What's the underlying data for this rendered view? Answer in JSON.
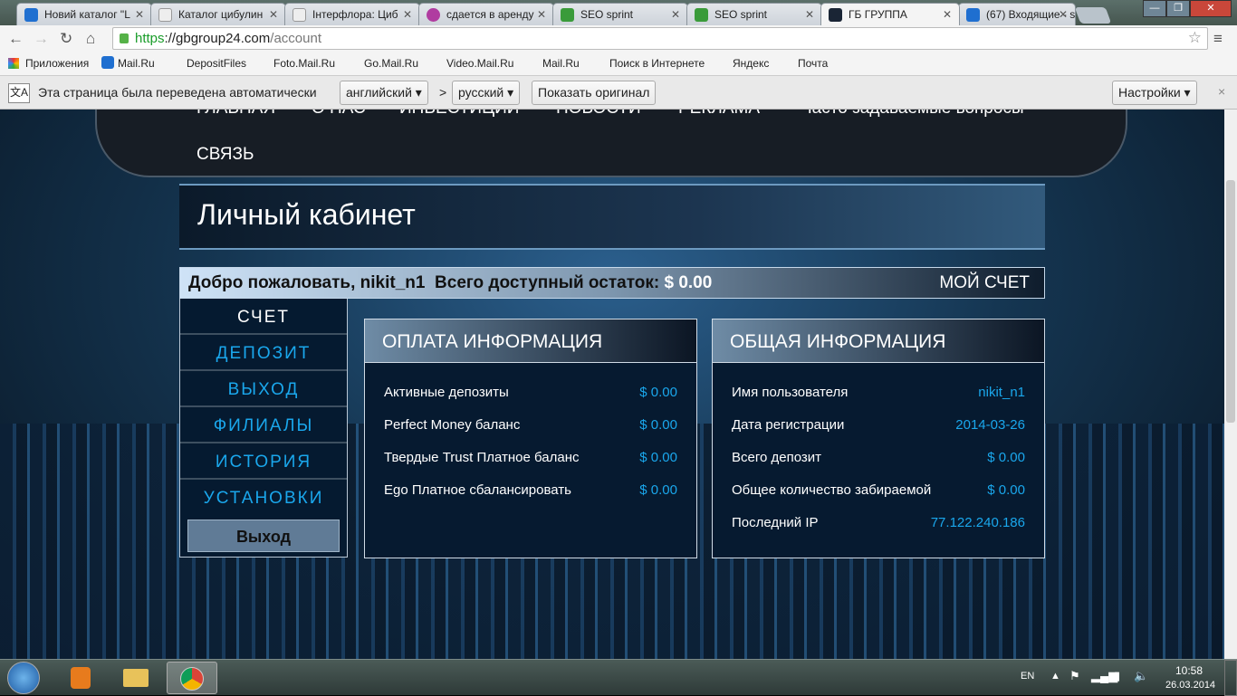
{
  "browser": {
    "tabs": [
      {
        "title": "Новий каталог \"L",
        "color": "#1f6fd0"
      },
      {
        "title": "Каталог цибулин",
        "color": "#eee"
      },
      {
        "title": "Інтерфлора: Циб",
        "color": "#eee"
      },
      {
        "title": "сдается в аренду",
        "color": "#b03ca0"
      },
      {
        "title": "SEO sprint",
        "color": "#3a9b3a"
      },
      {
        "title": "SEO sprint",
        "color": "#3a9b3a"
      },
      {
        "title": "ГБ ГРУППА",
        "color": "#1a2535"
      },
      {
        "title": "(67) Входящие - s",
        "color": "#1f6fd0"
      }
    ],
    "url_scheme": "https",
    "url_host": "://gbgroup24.com",
    "url_path": "/account",
    "bookmarks": [
      "Приложения",
      "Mail.Ru",
      "DepositFiles",
      "Foto.Mail.Ru",
      "Go.Mail.Ru",
      "Video.Mail.Ru",
      "Mail.Ru",
      "Поиск в Интернете",
      "Яндекс",
      "Почта"
    ],
    "translate": {
      "message": "Эта страница была переведена автоматически",
      "from": "английский",
      "sep": ">",
      "to": "русский",
      "show_original": "Показать оригинал",
      "settings": "Настройки",
      "close": "×"
    }
  },
  "site": {
    "nav": [
      "ГЛАВНАЯ",
      "О НАС",
      "ИНВЕСТИЦИИ",
      "НОВОСТИ",
      "РЕКЛАМА",
      "Часто задаваемые вопросы",
      "СВЯЗЬ"
    ],
    "page_title": "Личный кабинет",
    "welcome": "Добро пожаловать, nikit_n1",
    "balance_label": "Всего доступный остаток:",
    "balance": "$ 0.00",
    "my_account": "МОЙ СЧЕТ",
    "sidebar": [
      "СЧЕТ",
      "ДЕПОЗИТ",
      "ВЫХОД",
      "ФИЛИАЛЫ",
      "ИСТОРИЯ",
      "УСТАНОВКИ"
    ],
    "logout": "Выход",
    "payment": {
      "title": "ОПЛАТА ИНФОРМАЦИЯ",
      "rows": [
        {
          "label": "Активные депозиты",
          "value": "$ 0.00"
        },
        {
          "label": "Perfect Money баланс",
          "value": "$ 0.00"
        },
        {
          "label": "Твердые Trust Платное баланс",
          "value": "$ 0.00"
        },
        {
          "label": "Ego Платное сбалансировать",
          "value": "$ 0.00"
        }
      ]
    },
    "general": {
      "title": "ОБЩАЯ ИНФОРМАЦИЯ",
      "rows": [
        {
          "label": "Имя пользователя",
          "value": "nikit_n1"
        },
        {
          "label": "Дата регистрации",
          "value": "2014-03-26"
        },
        {
          "label": "Всего депозит",
          "value": "$ 0.00"
        },
        {
          "label": "Общее количество забираемой",
          "value": "$ 0.00"
        },
        {
          "label": "Последний IP",
          "value": "77.122.240.186"
        }
      ]
    }
  },
  "taskbar": {
    "lang": "EN",
    "time": "10:58",
    "date": "26.03.2014"
  }
}
